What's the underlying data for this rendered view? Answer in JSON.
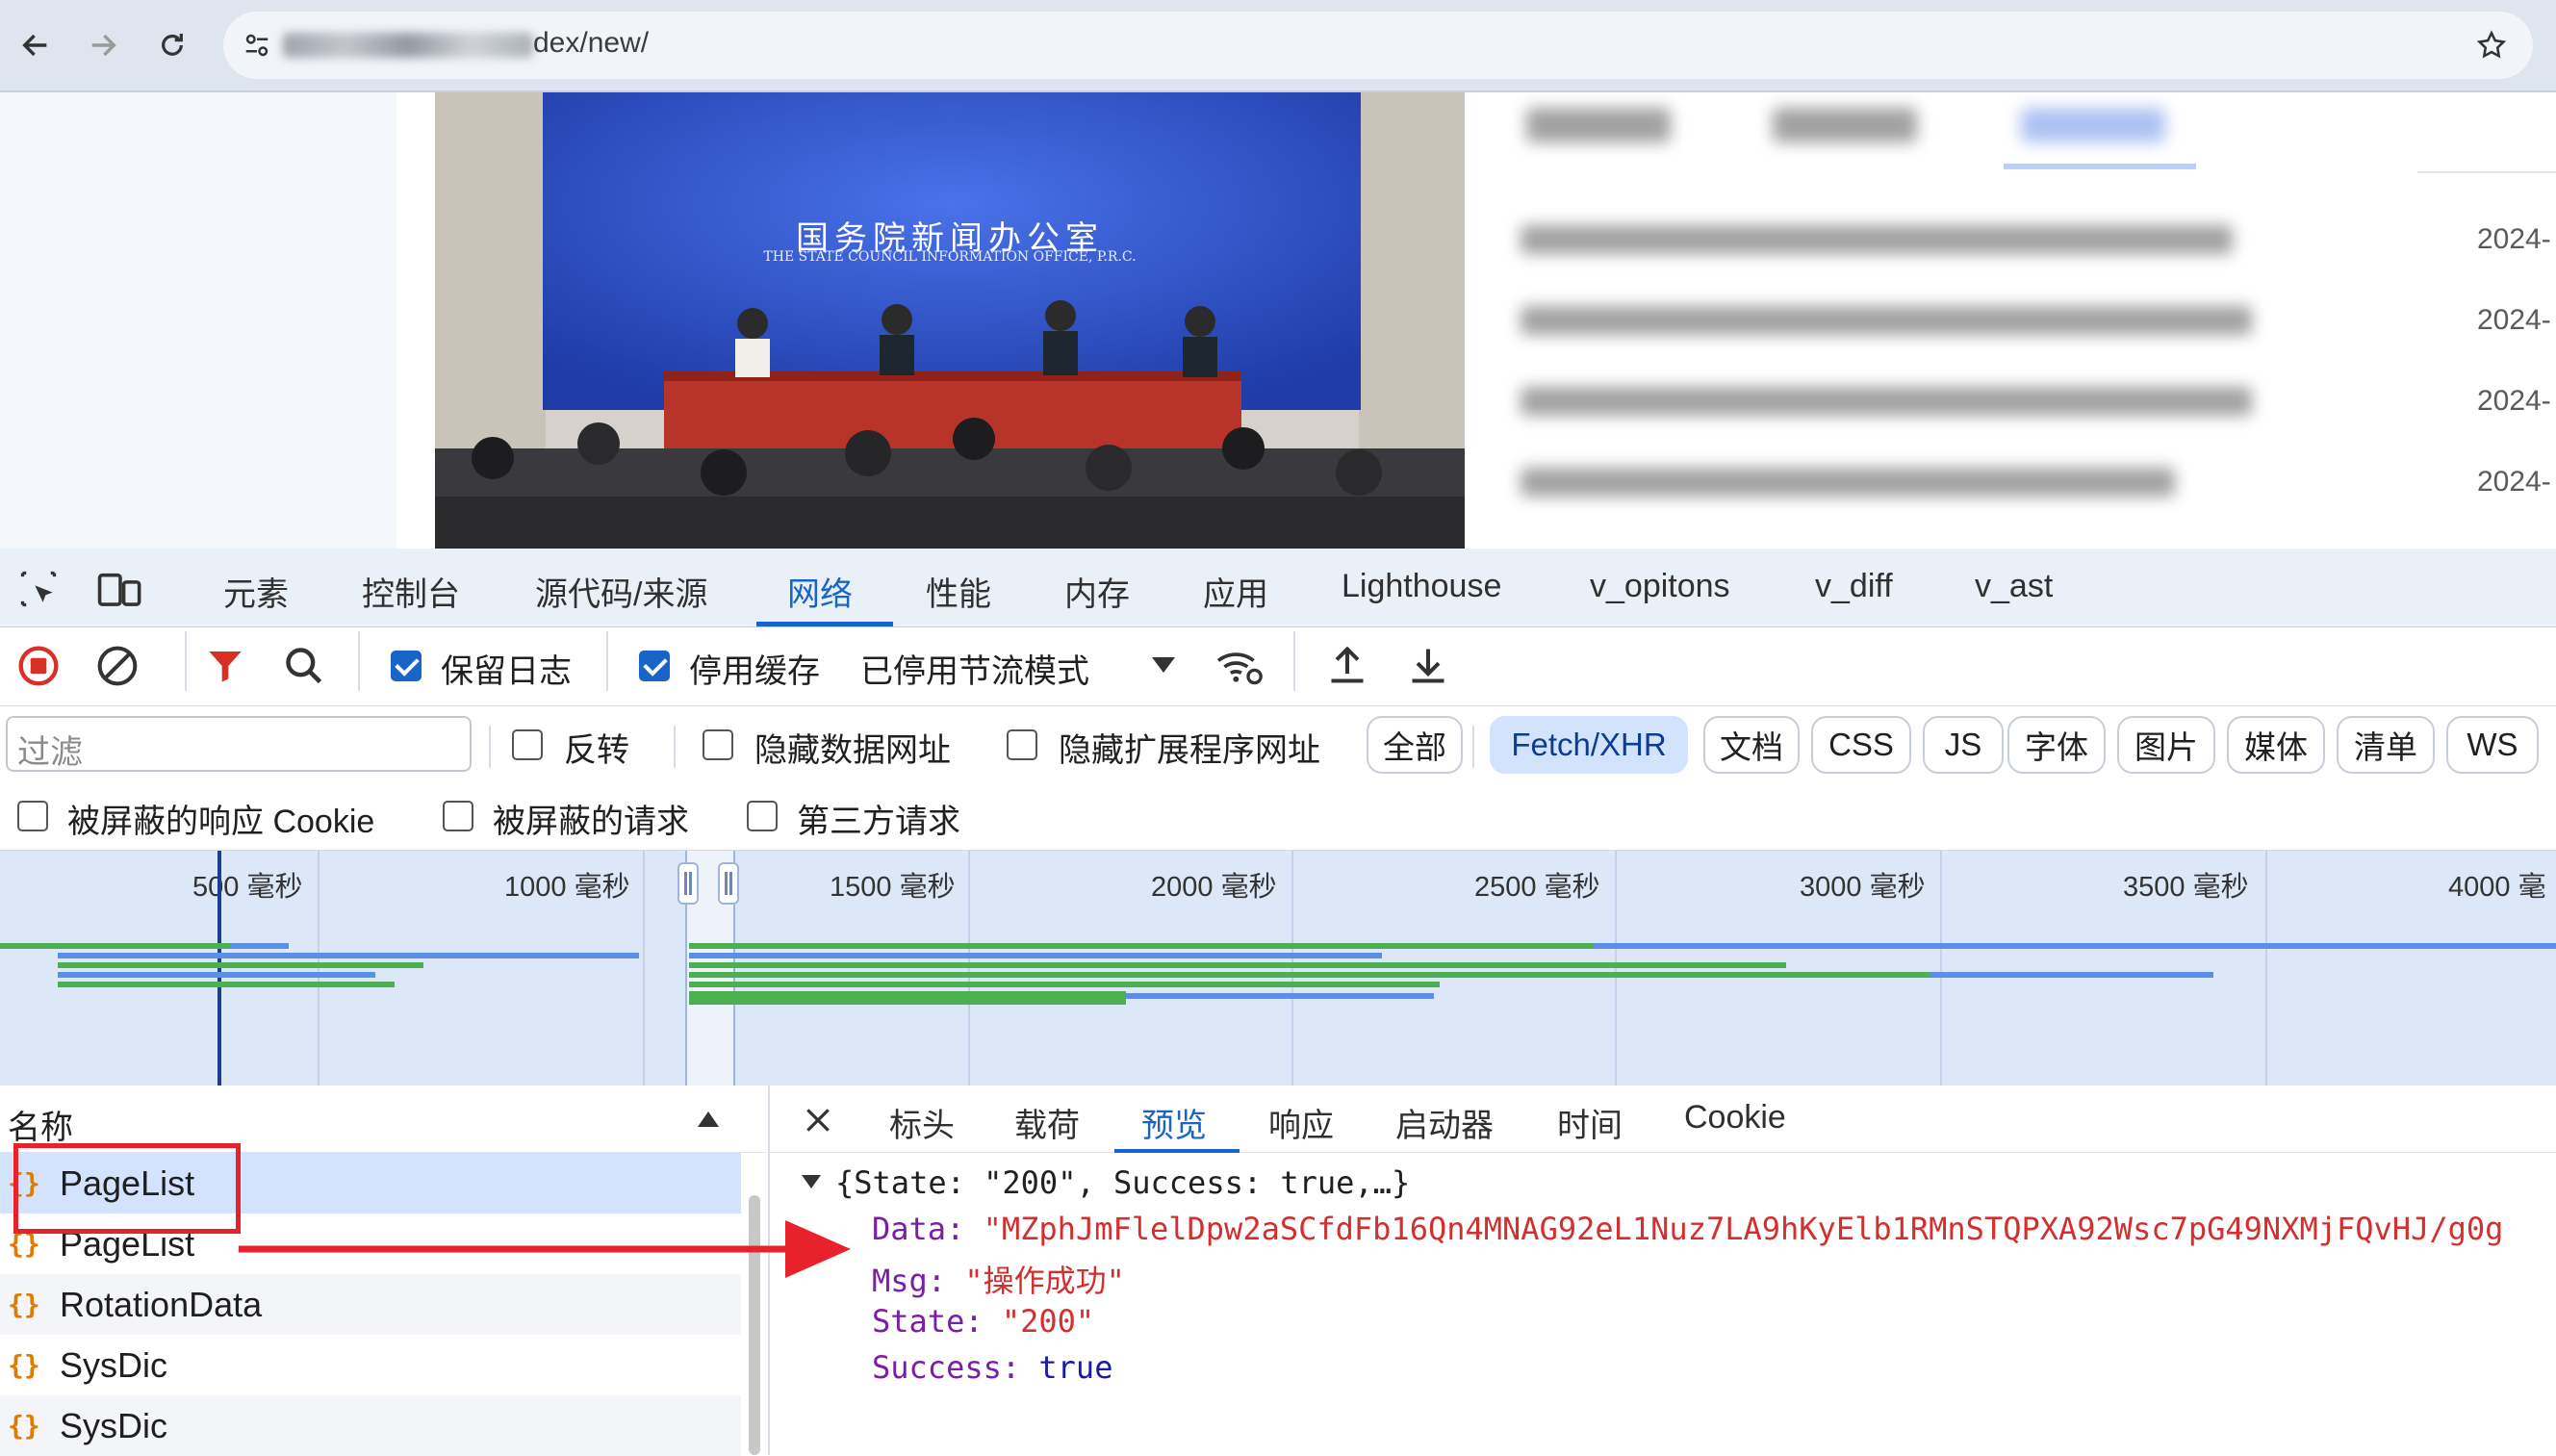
{
  "browser": {
    "url_suffix": "dex/new/",
    "icons": {
      "back": "back-arrow-icon",
      "forward": "forward-arrow-icon",
      "reload": "reload-icon",
      "site_info": "tune-icon",
      "bookmark": "star-icon"
    }
  },
  "page": {
    "banner": {
      "title_cn": "国务院新闻办公室",
      "title_en": "THE STATE COUNCIL INFORMATION OFFICE, P.R.C."
    },
    "news_dates": [
      "2024-",
      "2024-",
      "2024-",
      "2024-"
    ]
  },
  "devtools": {
    "tabs": [
      "元素",
      "控制台",
      "源代码/来源",
      "网络",
      "性能",
      "内存",
      "应用",
      "Lighthouse",
      "v_opitons",
      "v_diff",
      "v_ast"
    ],
    "active_tab": "网络",
    "toolbar": {
      "preserve_log": "保留日志",
      "disable_cache": "停用缓存",
      "throttling": "已停用节流模式"
    },
    "filter": {
      "placeholder": "过滤",
      "invert": "反转",
      "hide_data_urls": "隐藏数据网址",
      "hide_ext_urls": "隐藏扩展程序网址",
      "types": [
        "全部",
        "Fetch/XHR",
        "文档",
        "CSS",
        "JS",
        "字体",
        "图片",
        "媒体",
        "清单",
        "WS"
      ],
      "selected_type": "Fetch/XHR",
      "blocked_cookies": "被屏蔽的响应 Cookie",
      "blocked_requests": "被屏蔽的请求",
      "third_party": "第三方请求"
    },
    "timeline": {
      "ticks": [
        "500 毫秒",
        "1000 毫秒",
        "1500 毫秒",
        "2000 毫秒",
        "2500 毫秒",
        "3000 毫秒",
        "3500 毫秒",
        "4000 毫"
      ]
    },
    "requests": {
      "column": "名称",
      "items": [
        "PageList",
        "PageList",
        "RotationData",
        "SysDic",
        "SysDic"
      ]
    },
    "detail": {
      "tabs": [
        "标头",
        "载荷",
        "预览",
        "响应",
        "启动器",
        "时间",
        "Cookie"
      ],
      "active_tab": "预览",
      "preview": {
        "summary": "{State: \"200\", Success: true,…}",
        "data_key": "Data",
        "data_value": "\"MZphJmFlelDpw2aSCfdFb16Qn4MNAG92eL1Nuz7LA9hKyElb1RMnSTQPXA92Wsc7pG49NXMjFQvHJ/g0g",
        "msg_key": "Msg",
        "msg_value": "\"操作成功\"",
        "state_key": "State",
        "state_value": "\"200\"",
        "success_key": "Success",
        "success_value": "true"
      }
    }
  },
  "colors": {
    "accent": "#1a64c8",
    "annotation": "#e8222a",
    "xhr_icon": "#e07b00"
  }
}
